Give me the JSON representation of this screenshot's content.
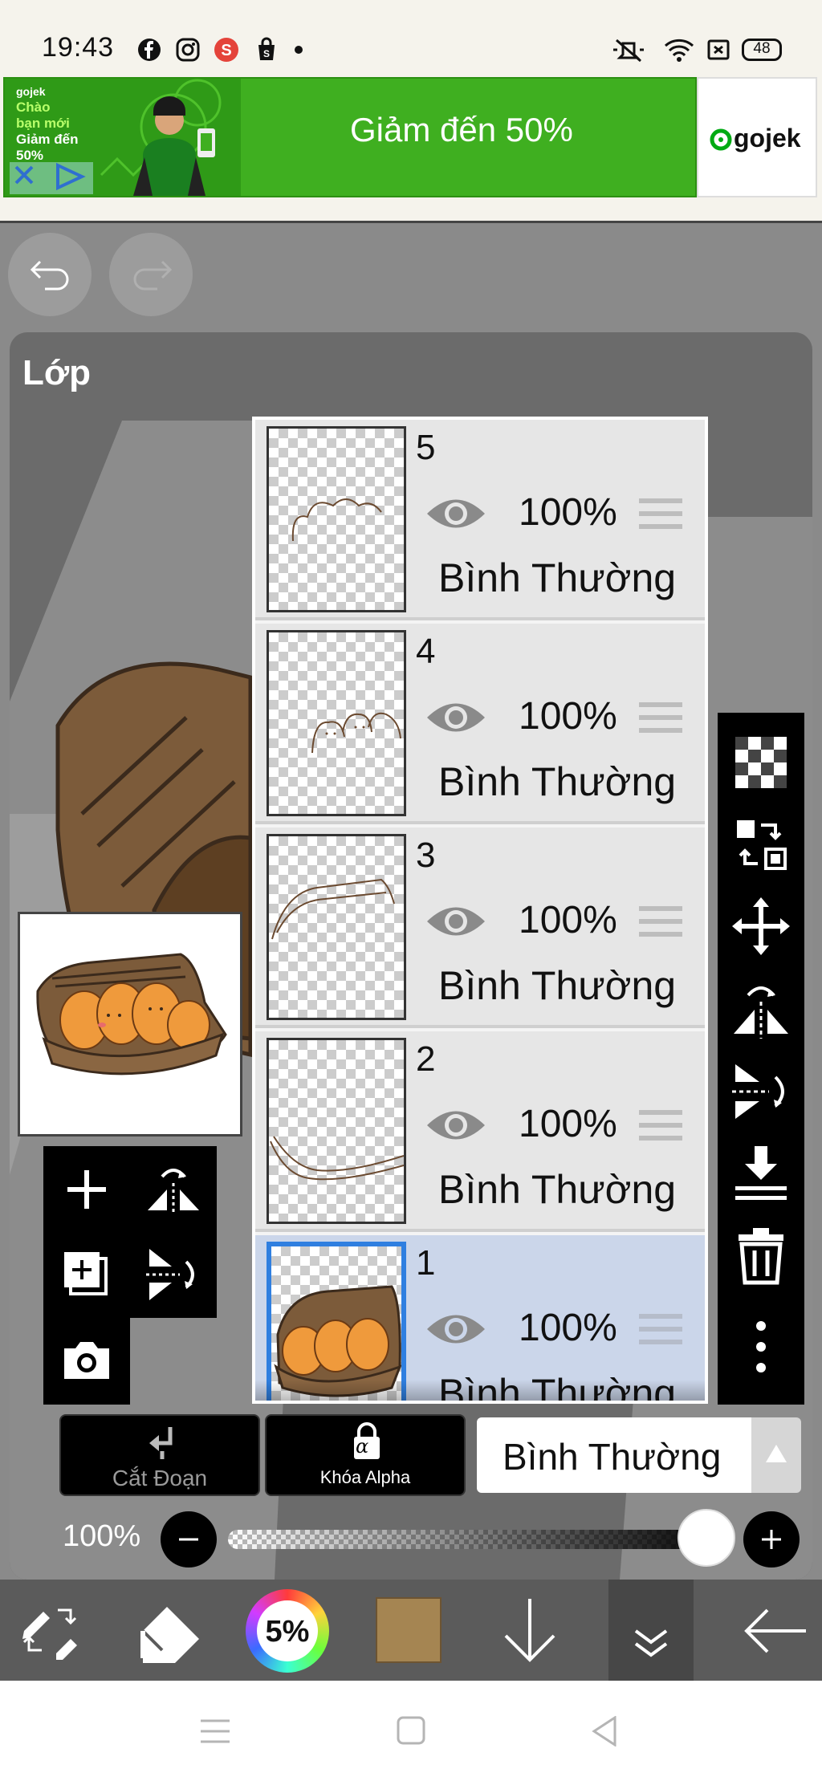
{
  "status_bar": {
    "time": "19:43",
    "battery": "48",
    "left_icons": [
      "facebook-icon",
      "instagram-icon",
      "shopee-icon",
      "shopping-bag-icon",
      "dot-icon"
    ],
    "right_icons": [
      "mute-icon",
      "wifi-icon",
      "sim-icon",
      "battery-icon"
    ]
  },
  "ad": {
    "brand_small": "gojek",
    "left_text": [
      "Chào",
      "bạn mới",
      "Giảm đến",
      "50%"
    ],
    "headline": "Giảm đến 50%",
    "brand": "gojek",
    "accent_color": "#3faf20"
  },
  "history": {
    "undo_icon": "undo-icon",
    "redo_icon": "redo-icon"
  },
  "panel": {
    "title": "Lớp"
  },
  "layers": [
    {
      "number": "5",
      "opacity": "100%",
      "blend": "Bình Thường",
      "selected": false
    },
    {
      "number": "4",
      "opacity": "100%",
      "blend": "Bình Thường",
      "selected": false
    },
    {
      "number": "3",
      "opacity": "100%",
      "blend": "Bình Thường",
      "selected": false
    },
    {
      "number": "2",
      "opacity": "100%",
      "blend": "Bình Thường",
      "selected": false
    },
    {
      "number": "1",
      "opacity": "100%",
      "blend": "Bình Thường",
      "selected": true
    }
  ],
  "right_toolbar": [
    "transparency-icon",
    "swap-layer-icon",
    "move-icon",
    "flip-horizontal-icon",
    "flip-vertical-icon",
    "merge-down-icon",
    "trash-icon",
    "more-icon"
  ],
  "left_tools": [
    "add-layer-icon",
    "flip-h-rotate-icon",
    "add-copy-icon",
    "flip-v-rotate-icon",
    "camera-icon"
  ],
  "controls": {
    "clip_label": "Cắt Đoạn",
    "alpha_label": "Khóa Alpha",
    "alpha_glyph": "α",
    "blend_mode": "Bình Thường",
    "opacity_label": "100%",
    "opacity_value": 1.0
  },
  "bottom_toolbar": {
    "color_wheel_label": "5%",
    "current_color": "#a58552",
    "icons": [
      "tools-swap-icon",
      "eraser-icon",
      "color-wheel-icon",
      "color-swatch-icon",
      "arrow-down-icon",
      "chevron-double-down-icon",
      "back-arrow-icon"
    ]
  },
  "nav": [
    "menu-icon",
    "home-icon",
    "back-icon"
  ]
}
